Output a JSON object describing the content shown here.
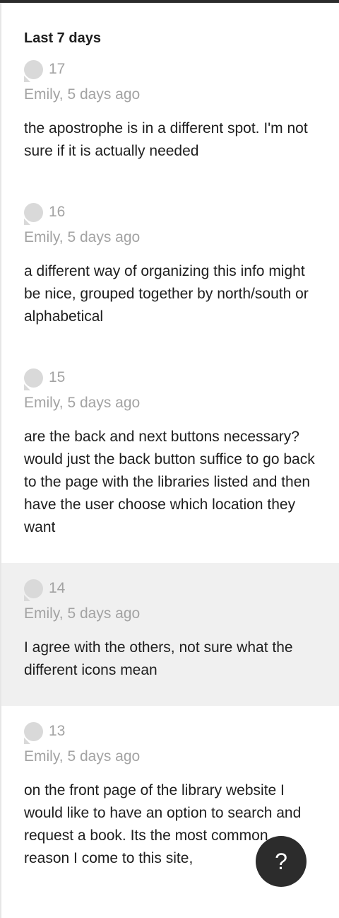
{
  "section": {
    "title": "Last 7 days"
  },
  "comments": [
    {
      "number": "17",
      "meta": "Emily, 5 days ago",
      "text": "the apostrophe is in a different spot. I'm not sure if it is actually needed",
      "highlighted": false
    },
    {
      "number": "16",
      "meta": "Emily, 5 days ago",
      "text": "a different way of organizing this info might be nice, grouped together by north/south or alphabetical",
      "highlighted": false
    },
    {
      "number": "15",
      "meta": "Emily, 5 days ago",
      "text": "are the back and next buttons necessary? would just the back button suffice to go back to the page with the libraries listed and then have the user choose which location they want",
      "highlighted": false
    },
    {
      "number": "14",
      "meta": "Emily, 5 days ago",
      "text": "I agree with the others, not sure what the different icons mean",
      "highlighted": true
    },
    {
      "number": "13",
      "meta": "Emily, 5 days ago",
      "text": "on the front page of the library website I would like to have an option to search and request a book. Its the most common reason I come to this site,",
      "highlighted": false
    }
  ],
  "help": {
    "label": "?",
    "icon": "help-icon"
  },
  "colors": {
    "top_bar": "#2c2c2c",
    "highlight_bg": "#f0f0f0",
    "muted_text": "#a3a3a3",
    "bubble": "#d9d9d9",
    "help_button_bg": "#2c2c2c"
  }
}
